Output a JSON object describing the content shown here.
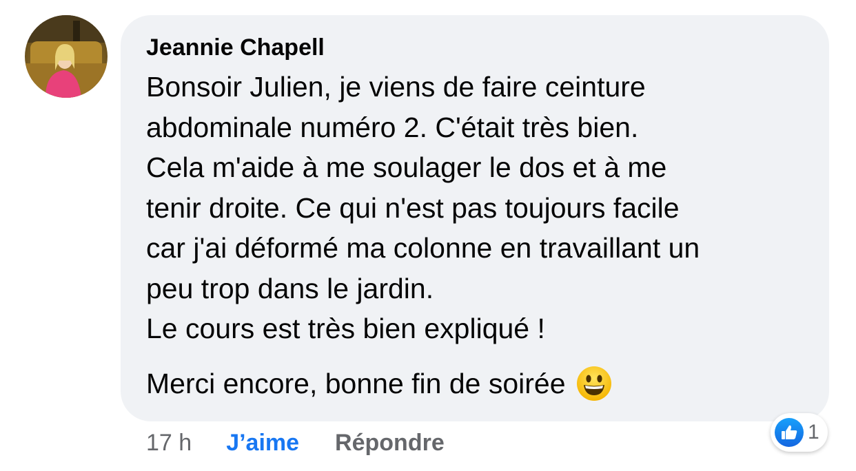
{
  "comment": {
    "author": "Jeannie Chapell",
    "body_lines": [
      "Bonsoir Julien, je viens de faire ceinture",
      "abdominale numéro 2. C'était très bien.",
      "Cela m'aide à me soulager le dos et à me",
      "tenir droite. Ce qui n'est pas toujours facile",
      "car j'ai déformé ma colonne en travaillant un",
      "peu trop dans le jardin.",
      "Le cours est très bien expliqué !"
    ],
    "closing": "Merci encore, bonne fin de soirée",
    "emoji_icon": "grinning-face-emoji"
  },
  "actions": {
    "time": "17 h",
    "like_label": "J’aime",
    "reply_label": "Répondre"
  },
  "reactions": {
    "icon": "thumbs-up-icon",
    "count": "1"
  },
  "colors": {
    "bubble_bg": "#f0f2f5",
    "like_blue": "#1877f2",
    "muted_text": "#65676b",
    "text": "#050505"
  }
}
